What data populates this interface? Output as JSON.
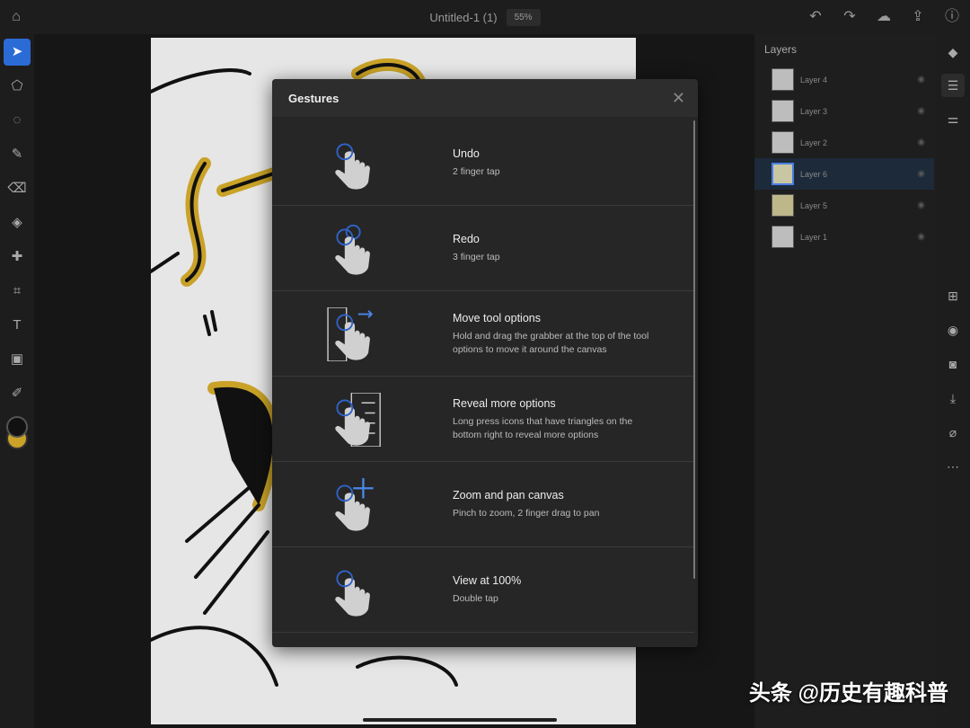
{
  "header": {
    "title": "Untitled-1 (1)",
    "zoom": "55%"
  },
  "layers": {
    "title": "Layers",
    "items": [
      {
        "label": "Layer 4"
      },
      {
        "label": "Layer 3"
      },
      {
        "label": "Layer 2"
      },
      {
        "label": "Layer 6",
        "selected": true
      },
      {
        "label": "Layer 5"
      },
      {
        "label": "Layer 1"
      }
    ]
  },
  "modal": {
    "title": "Gestures",
    "items": [
      {
        "title": "Undo",
        "desc": "2 finger tap"
      },
      {
        "title": "Redo",
        "desc": "3 finger tap"
      },
      {
        "title": "Move tool options",
        "desc": "Hold and drag the grabber at the top of the tool options to move it around the canvas"
      },
      {
        "title": "Reveal more options",
        "desc": "Long press icons that have triangles on the bottom right to reveal more options"
      },
      {
        "title": "Zoom and pan canvas",
        "desc": "Pinch to zoom, 2 finger drag to pan"
      },
      {
        "title": "View at 100%",
        "desc": "Double tap"
      }
    ]
  },
  "colors": {
    "accent": "#2b6bd6",
    "primary_swatch": "#111111",
    "secondary_swatch": "#c9a227"
  },
  "watermark": "头条 @历史有趣科普"
}
